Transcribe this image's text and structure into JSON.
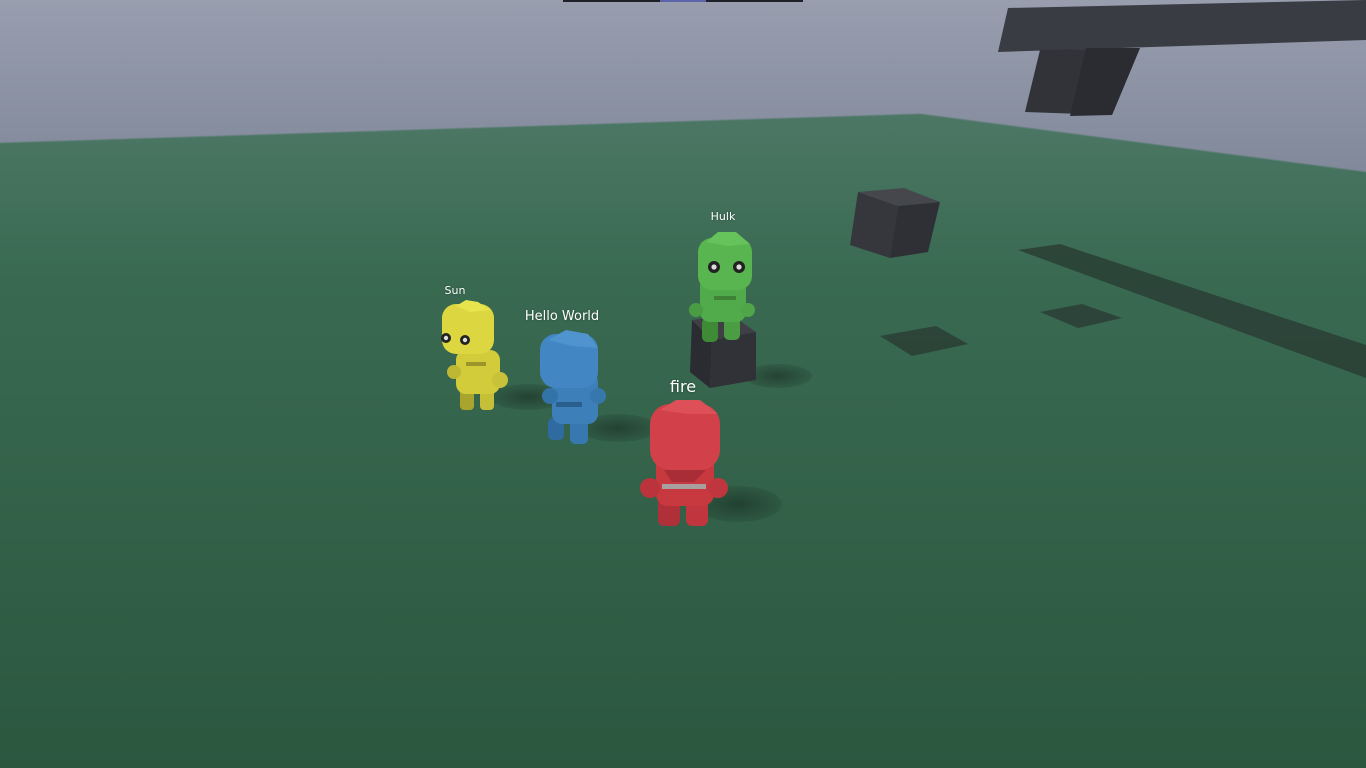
{
  "players": [
    {
      "name": "Sun",
      "color": "#d9d23c"
    },
    {
      "name": "Hello World",
      "color": "#3f83c0"
    },
    {
      "name": "Hulk",
      "color": "#4fae45"
    },
    {
      "name": "fire",
      "color": "#cf3a3f"
    }
  ],
  "colors": {
    "sky": "#8b93a6",
    "ground": "#2f5c45",
    "obstacle": "#34363c"
  }
}
